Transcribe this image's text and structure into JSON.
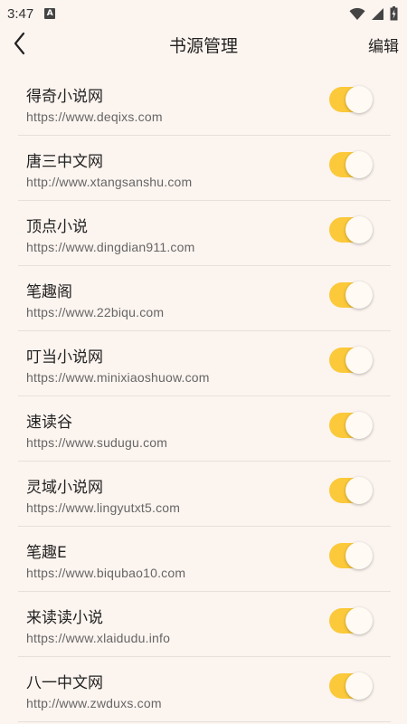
{
  "status_bar": {
    "time": "3:47",
    "notification_icon": "A",
    "icons": [
      "wifi-icon",
      "signal-icon",
      "battery-icon"
    ]
  },
  "toolbar": {
    "title": "书源管理",
    "edit_label": "编辑"
  },
  "sources": [
    {
      "name": "得奇小说网",
      "url": "https://www.deqixs.com",
      "enabled": true
    },
    {
      "name": "唐三中文网",
      "url": "http://www.xtangsanshu.com",
      "enabled": true
    },
    {
      "name": "顶点小说",
      "url": "https://www.dingdian911.com",
      "enabled": true
    },
    {
      "name": "笔趣阁",
      "url": "https://www.22biqu.com",
      "enabled": true
    },
    {
      "name": "叮当小说网",
      "url": "https://www.minixiaoshuow.com",
      "enabled": true
    },
    {
      "name": "速读谷",
      "url": "https://www.sudugu.com",
      "enabled": true
    },
    {
      "name": "灵域小说网",
      "url": "https://www.lingyutxt5.com",
      "enabled": true
    },
    {
      "name": "笔趣E",
      "url": "https://www.biqubao10.com",
      "enabled": true
    },
    {
      "name": "来读读小说",
      "url": "https://www.xlaidudu.info",
      "enabled": true
    },
    {
      "name": "八一中文网",
      "url": "http://www.zwduxs.com",
      "enabled": true
    }
  ],
  "colors": {
    "background": "#fcf4ef",
    "toggle_on": "#fbc93a",
    "divider": "#e6dfda"
  }
}
